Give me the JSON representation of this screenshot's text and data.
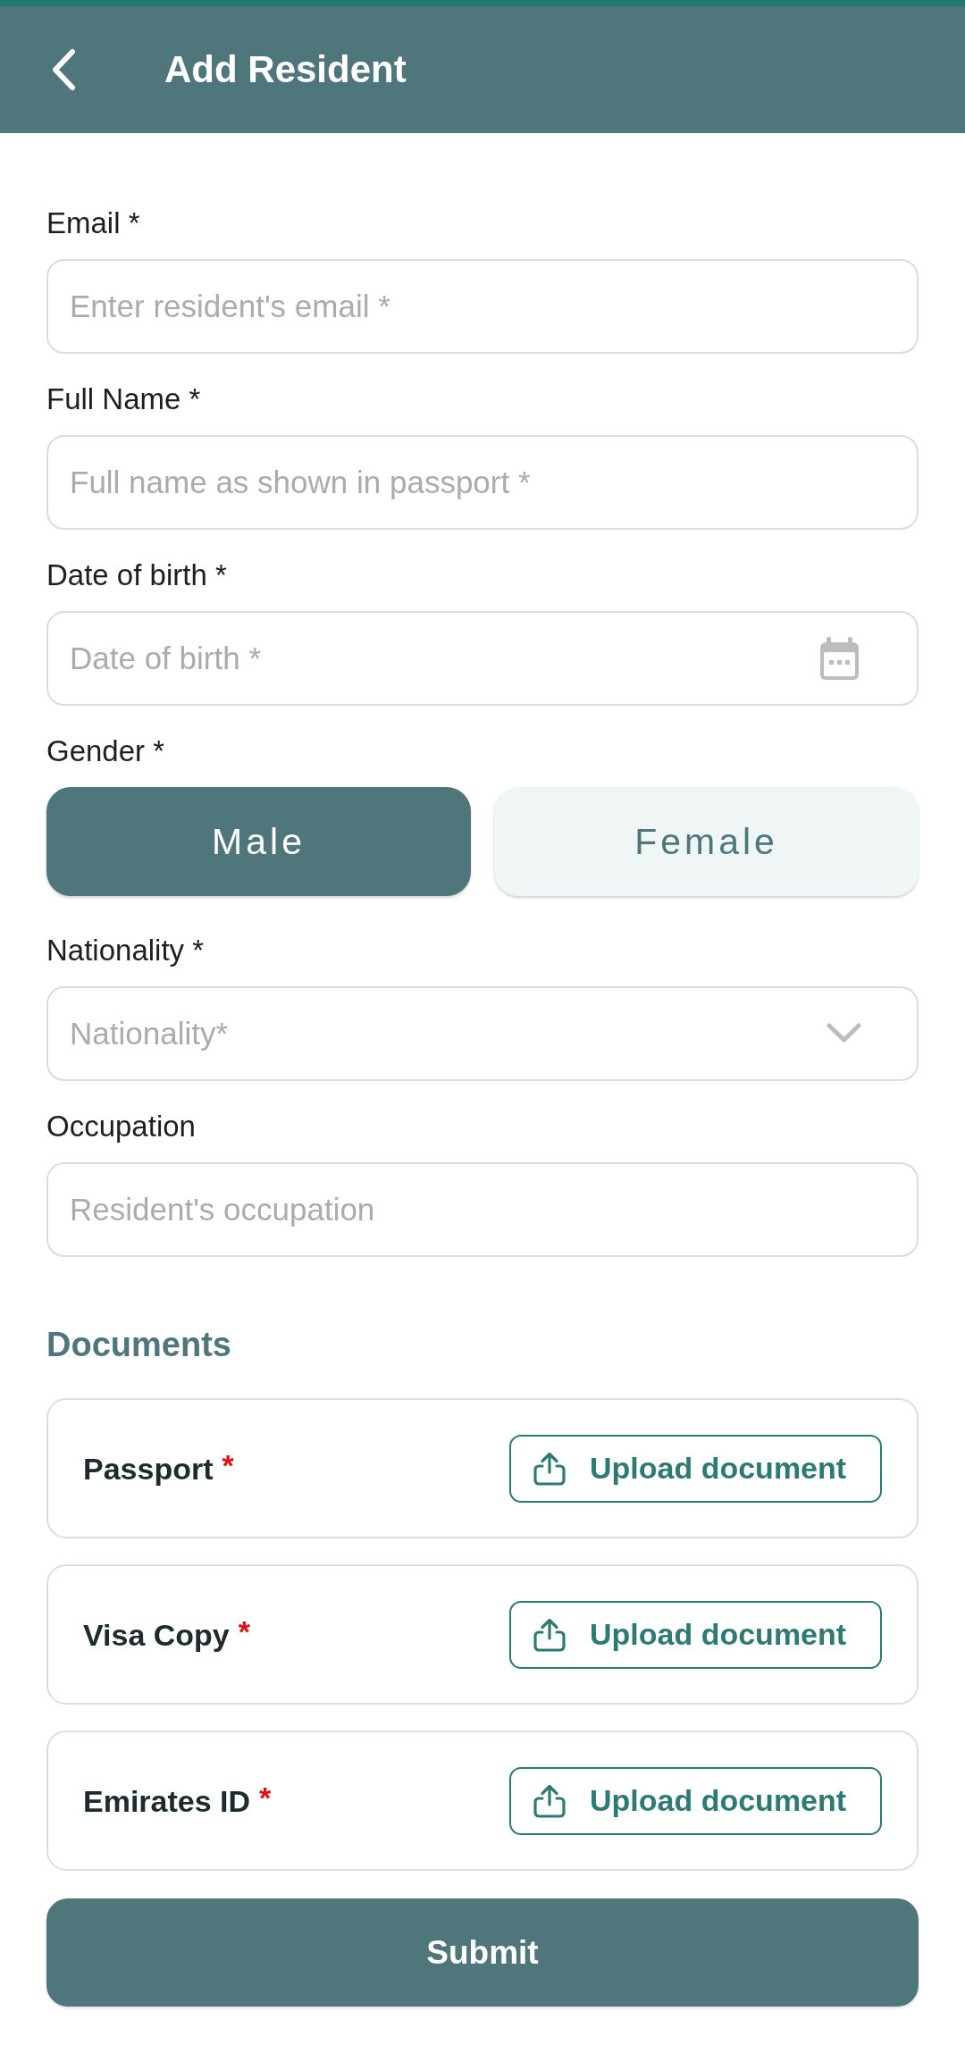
{
  "header": {
    "title": "Add Resident"
  },
  "fields": [
    {
      "kind": "text",
      "label": "Email *",
      "placeholder": "Enter resident's email *"
    },
    {
      "kind": "text",
      "label": "Full Name *",
      "placeholder": "Full name as shown in passport *"
    },
    {
      "kind": "date",
      "label": "Date of birth *",
      "placeholder": "Date of birth *"
    },
    {
      "kind": "choice",
      "label": "Gender *",
      "options": [
        {
          "label": "Male",
          "selected": true
        },
        {
          "label": "Female",
          "selected": false
        }
      ]
    },
    {
      "kind": "dropdown",
      "label": "Nationality *",
      "placeholder": "Nationality*"
    },
    {
      "kind": "text",
      "label": "Occupation",
      "placeholder": "Resident's occupation"
    }
  ],
  "documents": {
    "title": "Documents",
    "items": [
      {
        "name": "Passport",
        "required_mark": "*",
        "button": "Upload document"
      },
      {
        "name": "Visa Copy",
        "required_mark": "*",
        "button": "Upload document"
      },
      {
        "name": "Emirates ID",
        "required_mark": "*",
        "button": "Upload document"
      }
    ]
  },
  "submit": {
    "label": "Submit"
  }
}
